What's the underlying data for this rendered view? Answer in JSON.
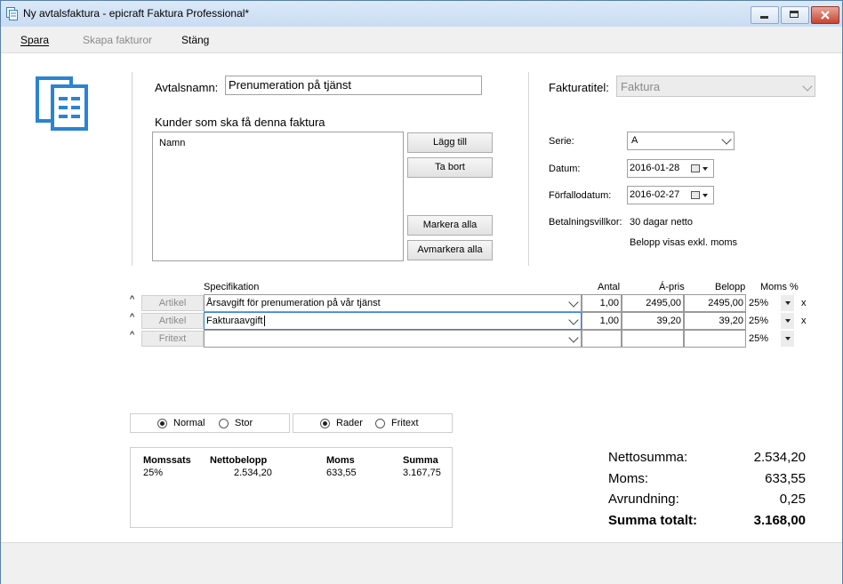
{
  "window": {
    "title": "Ny avtalsfaktura - epicraft Faktura Professional*"
  },
  "menu": {
    "save": "Spara",
    "create": "Skapa fakturor",
    "close": "Stäng"
  },
  "form": {
    "name_label": "Avtalsnamn:",
    "name_value": "Prenumeration på tjänst",
    "customers_label": "Kunder som ska få denna faktura",
    "customers_header": "Namn",
    "add_btn": "Lägg till",
    "remove_btn": "Ta bort",
    "select_all_btn": "Markera alla",
    "deselect_all_btn": "Avmarkera alla"
  },
  "invoice": {
    "title_label": "Fakturatitel:",
    "title_value": "Faktura",
    "series_label": "Serie:",
    "series_value": "A",
    "date_label": "Datum:",
    "date_value": "2016-01-28",
    "due_label": "Förfallodatum:",
    "due_value": "2016-02-27",
    "terms_label": "Betalningsvillkor:",
    "terms_value": "30 dagar netto",
    "price_note": "Belopp visas exkl. moms"
  },
  "lines": {
    "headers": {
      "spec": "Specifikation",
      "qty": "Antal",
      "unit": "Á-pris",
      "amount": "Belopp",
      "vat": "Moms %"
    },
    "rows": [
      {
        "type": "Artikel",
        "spec": "Årsavgift för prenumeration på vår tjänst",
        "qty": "1,00",
        "unit": "2495,00",
        "amount": "2495,00",
        "vat": "25%",
        "remove": "x",
        "caret": "^"
      },
      {
        "type": "Artikel",
        "spec": "Fakturaavgift",
        "qty": "1,00",
        "unit": "39,20",
        "amount": "39,20",
        "vat": "25%",
        "remove": "x",
        "caret": "^"
      },
      {
        "type": "Fritext",
        "spec": "",
        "qty": "",
        "unit": "",
        "amount": "",
        "vat": "25%",
        "remove": "",
        "caret": "^"
      }
    ]
  },
  "options": {
    "normal": "Normal",
    "large": "Stor",
    "rows": "Rader",
    "freetext": "Fritext",
    "normal_selected": true,
    "rows_selected": true
  },
  "vat_summary": {
    "headers": {
      "rate": "Momssats",
      "net": "Nettobelopp",
      "vat": "Moms",
      "sum": "Summa"
    },
    "row": {
      "rate": "25%",
      "net": "2.534,20",
      "vat": "633,55",
      "sum": "3.167,75"
    }
  },
  "totals": {
    "net_label": "Nettosumma:",
    "net": "2.534,20",
    "vat_label": "Moms:",
    "vat": "633,55",
    "round_label": "Avrundning:",
    "round": "0,25",
    "total_label": "Summa totalt:",
    "total": "3.168,00"
  },
  "colors": {
    "accent": "#2b83d1",
    "title_bg": "#dbe9f8"
  }
}
